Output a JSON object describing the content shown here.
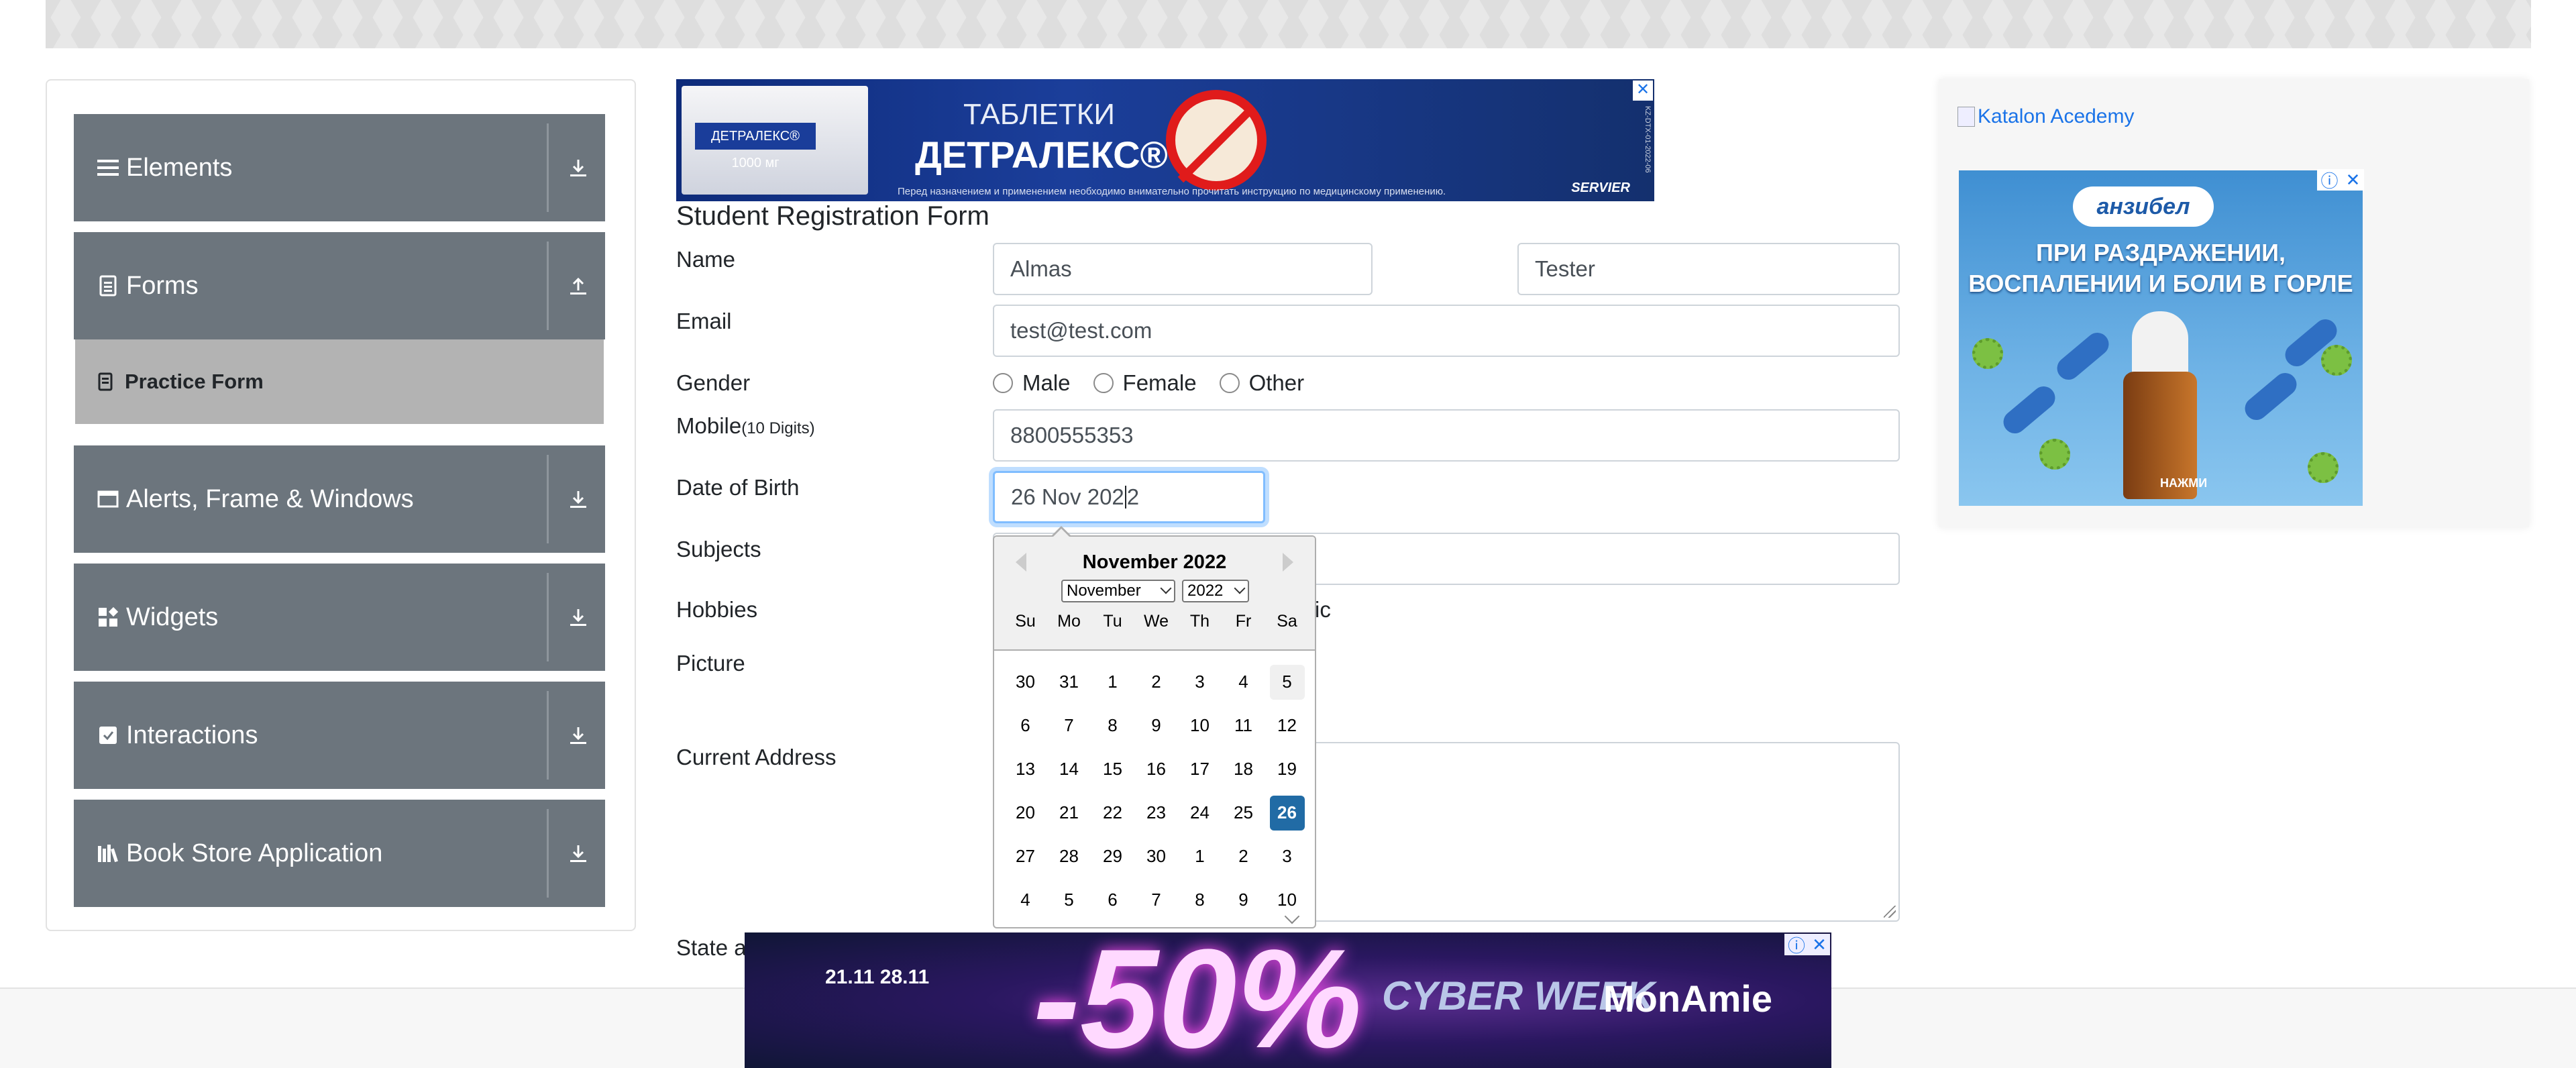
{
  "sidebar": {
    "groups": [
      {
        "label": "Elements",
        "icon": "menu-icon",
        "arrow": "download-arrow-icon"
      },
      {
        "label": "Forms",
        "icon": "document-icon",
        "arrow": "upload-arrow-icon"
      },
      {
        "label": "Alerts, Frame & Windows",
        "icon": "window-icon",
        "arrow": "download-arrow-icon"
      },
      {
        "label": "Widgets",
        "icon": "widgets-icon",
        "arrow": "download-arrow-icon"
      },
      {
        "label": "Interactions",
        "icon": "interactions-icon",
        "arrow": "download-arrow-icon"
      },
      {
        "label": "Book Store Application",
        "icon": "books-icon",
        "arrow": "download-arrow-icon"
      }
    ],
    "active_item": {
      "label": "Practice Form",
      "icon": "badge-icon"
    }
  },
  "ads": {
    "top": {
      "line1": "ТАБЛЕТКИ",
      "line2": "ДЕТРАЛЕКС®",
      "pack": "ДЕТРАЛЕКС® 1000 мг",
      "fine_print": "Перед назначением и применением необходимо внимательно прочитать инструкцию по медицинскому применению.",
      "brand": "SERVIER",
      "code": "KZ-DTX-01-2022-06",
      "close": "✕"
    },
    "right": {
      "link_text": "Katalon Acedemy",
      "logo": "анзибел",
      "text": "ПРИ РАЗДРАЖЕНИИ, ВОСПАЛЕНИИ И БОЛИ В ГОРЛЕ",
      "button": "НАЖМИ",
      "info": "ⓘ",
      "close": "✕"
    },
    "bottom": {
      "dates": "21.11 28.11",
      "discount": "-50%",
      "cyber": "CYBER WEEK",
      "brand": "MonAmie",
      "info": "ⓘ",
      "close": "✕"
    }
  },
  "form": {
    "title": "Student Registration Form",
    "name_label": "Name",
    "first_name": "Almas",
    "last_name": "Tester",
    "email_label": "Email",
    "email": "test@test.com",
    "gender_label": "Gender",
    "gender_options": [
      "Male",
      "Female",
      "Other"
    ],
    "mobile_label": "Mobile",
    "mobile_hint": "(10 Digits)",
    "mobile": "8800555353",
    "dob_label": "Date of Birth",
    "dob_before_caret": "26 Nov 202",
    "dob_after_caret": "2",
    "subjects_label": "Subjects",
    "hobbies_label": "Hobbies",
    "hobbies_visible_fragment": "ic",
    "picture_label": "Picture",
    "address_label": "Current Address",
    "state_label_fragment": "State a"
  },
  "datepicker": {
    "title": "November 2022",
    "month_select": "November",
    "year_select": "2022",
    "day_names": [
      "Su",
      "Mo",
      "Tu",
      "We",
      "Th",
      "Fr",
      "Sa"
    ],
    "weeks": [
      [
        "30",
        "31",
        "1",
        "2",
        "3",
        "4",
        "5"
      ],
      [
        "6",
        "7",
        "8",
        "9",
        "10",
        "11",
        "12"
      ],
      [
        "13",
        "14",
        "15",
        "16",
        "17",
        "18",
        "19"
      ],
      [
        "20",
        "21",
        "22",
        "23",
        "24",
        "25",
        "26"
      ],
      [
        "27",
        "28",
        "29",
        "30",
        "1",
        "2",
        "3"
      ],
      [
        "4",
        "5",
        "6",
        "7",
        "8",
        "9",
        "10"
      ]
    ],
    "selected": "26",
    "colors": {
      "selected_bg": "#216ba5",
      "header_bg": "#f0f0f0"
    }
  },
  "colors": {
    "sidebar_group_bg": "#6c757d",
    "sidebar_active_bg": "#b3b3b3",
    "focus_border": "#80bdff",
    "link": "#1a73e8"
  }
}
